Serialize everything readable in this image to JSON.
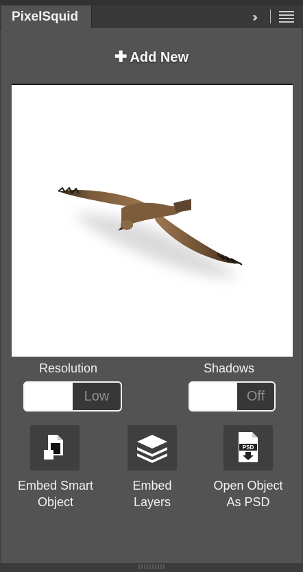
{
  "panel": {
    "tab_title": "PixelSquid"
  },
  "header": {
    "collapse_icon": "double-chevron-right-icon",
    "menu_icon": "hamburger-menu-icon"
  },
  "actions": {
    "add_new_label": "Add New",
    "add_new_icon": "plus-icon"
  },
  "preview": {
    "subject": "eagle-3d-object"
  },
  "settings": {
    "resolution": {
      "label": "Resolution",
      "value": "Low"
    },
    "shadows": {
      "label": "Shadows",
      "value": "Off"
    }
  },
  "buttons": {
    "embed_smart_object": {
      "line1": "Embed Smart",
      "line2": "Object",
      "icon": "smart-object-icon"
    },
    "embed_layers": {
      "line1": "Embed",
      "line2": "Layers",
      "icon": "layers-icon"
    },
    "open_psd": {
      "line1": "Open Object",
      "line2": "As PSD",
      "icon": "psd-file-icon"
    }
  },
  "colors": {
    "panel_bg": "#535353",
    "button_bg": "#3f3f3f",
    "toggle_knob": "#373737"
  }
}
